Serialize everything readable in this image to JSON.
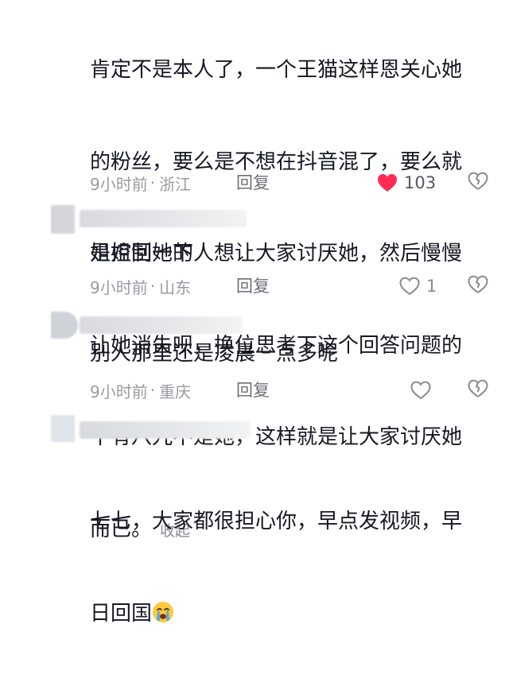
{
  "comment_top": {
    "lines": [
      "肯定不是本人了，一个王猫这样恩关心她",
      "的粉丝，要么是不想在抖音混了，要么就",
      "是控制她的人想让大家讨厌她，然后慢慢",
      "让她消失呗，换位思考下这个回答问题的",
      "十有八九不是她，这样就是让大家讨厌她",
      "而已。"
    ],
    "collapse_label": "收起",
    "time": "9小时前",
    "sep": "·",
    "location": "浙江",
    "reply_label": "回复",
    "like_count": "103"
  },
  "comment_2": {
    "text": "姐姐回一下",
    "time": "9小时前",
    "sep": "·",
    "location": "山东",
    "reply_label": "回复",
    "like_count": "1"
  },
  "comment_3": {
    "text": "别人那里还是凌晨一点多呢",
    "time": "9小时前",
    "sep": "·",
    "location": "重庆",
    "reply_label": "回复"
  },
  "comment_4": {
    "lines": [
      "七七，大家都很担心你，早点发视频，早",
      "日回国"
    ],
    "emoji": "crying-face-emoji"
  },
  "colors": {
    "text": "#161823",
    "meta": "#9a9ba1",
    "like_red": "#fe2c55",
    "icon_gray": "#8a8b91"
  }
}
